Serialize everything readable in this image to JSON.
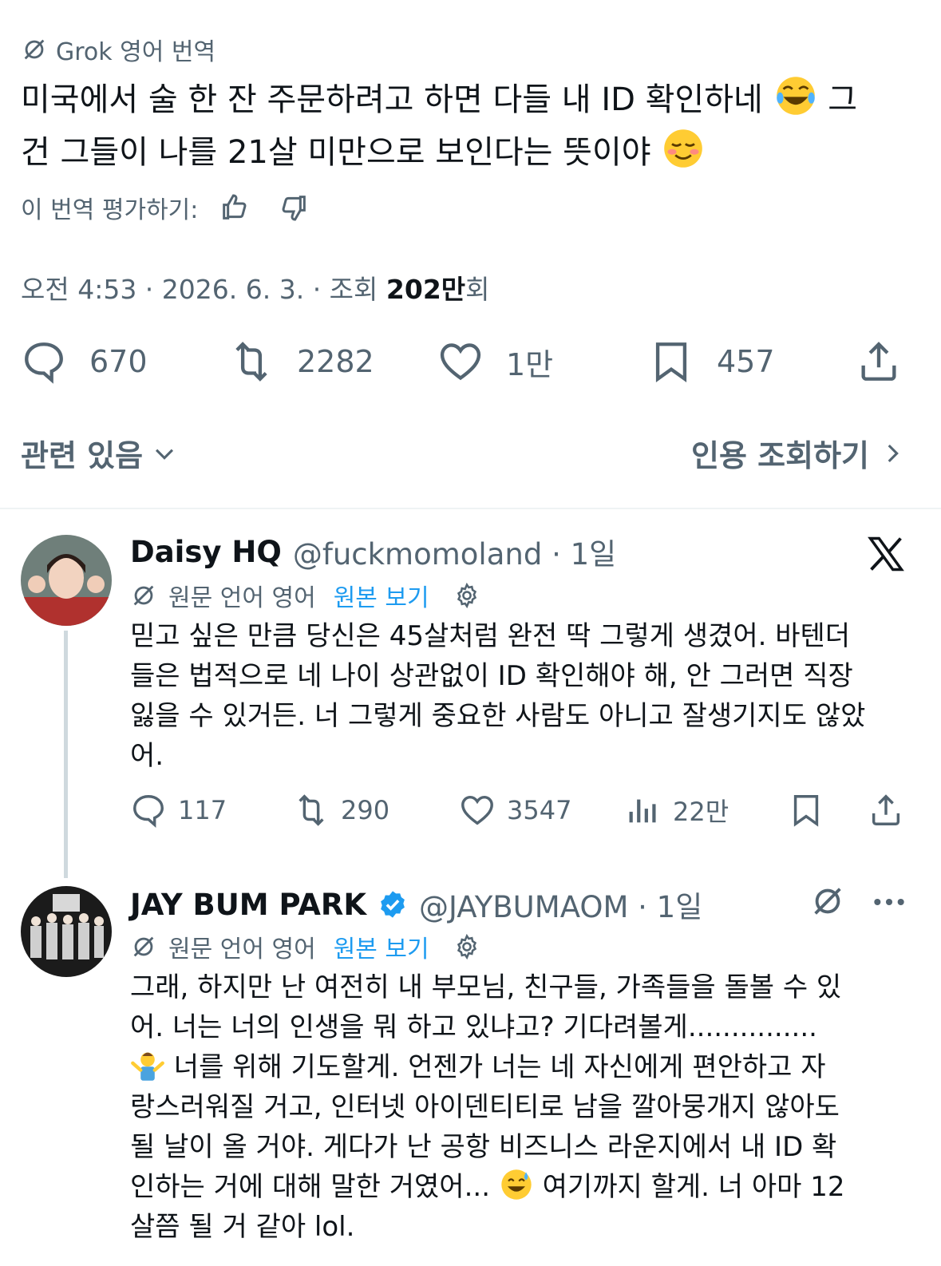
{
  "translation_header": {
    "label": "Grok 영어 번역"
  },
  "main_tweet": {
    "text": "미국에서 술 한 잔 주문하려고 하면 다들 내 ID 확인하네 ",
    "text_cont": " 그\n건 그들이 나를 21살 미만으로 보인다는 뜻이야 ",
    "emoji_1": "laughing-tears-emoji",
    "emoji_2": "smiling-blush-emoji"
  },
  "rate": {
    "label": "이 번역 평가하기:"
  },
  "meta": {
    "time": "오전 4:53 · 2026. 6. 3. · 조회 ",
    "views": "202만",
    "views_suffix": "회"
  },
  "actions": {
    "replies": "670",
    "retweets": "2282",
    "likes": "1만",
    "bookmarks": "457"
  },
  "related": {
    "label": "관련 있음"
  },
  "quote_link": {
    "label": "인용 조회하기"
  },
  "replies": [
    {
      "name": "Daisy HQ",
      "handle": "@fuckmomoland · 1일",
      "trans_label": "원문 언어 영어",
      "trans_link": "원본 보기",
      "text": "믿고 싶은 만큼 당신은 45살처럼 완전 딱 그렇게 생겼어. 바텐더\n들은 법적으로 네 나이 상관없이 ID 확인해야 해, 안 그러면 직장\n잃을 수 있거든. 너 그렇게 중요한 사람도 아니고 잘생기지도 않았\n어.",
      "stats": {
        "replies": "117",
        "retweets": "290",
        "likes": "3547",
        "views": "22만"
      }
    },
    {
      "name": "JAY BUM PARK",
      "handle": "@JAYBUMAOM · 1일",
      "trans_label": "원문 언어 영어",
      "trans_link": "원본 보기",
      "text_a": "그래, 하지만 난 여전히 내 부모님, 친구들, 가족들을 돌볼 수 있\n어. 너는 너의 인생을 뭐 하고 있냐고? 기다려볼게...............\n",
      "text_b": " 너를 위해 기도할게. 언젠가 너는 네 자신에게 편안하고 자\n랑스러워질 거고, 인터넷 아이덴티티로 남을 깔아뭉개지 않아도\n될 날이 올 거야. 게다가 난 공항 비즈니스 라운지에서 내 ID 확\n인하는 거에 대해 말한 거였어... ",
      "text_c": " 여기까지 할게. 너 아마 12\n살쯤 될 거 같아 lol.",
      "emoji_shrug": "man-shrugging-emoji",
      "emoji_sweat": "grinning-sweat-emoji"
    }
  ],
  "colors": {
    "text": "#0f1419",
    "muted": "#536471",
    "link": "#1d9bf0",
    "verified": "#1d9bf0"
  }
}
